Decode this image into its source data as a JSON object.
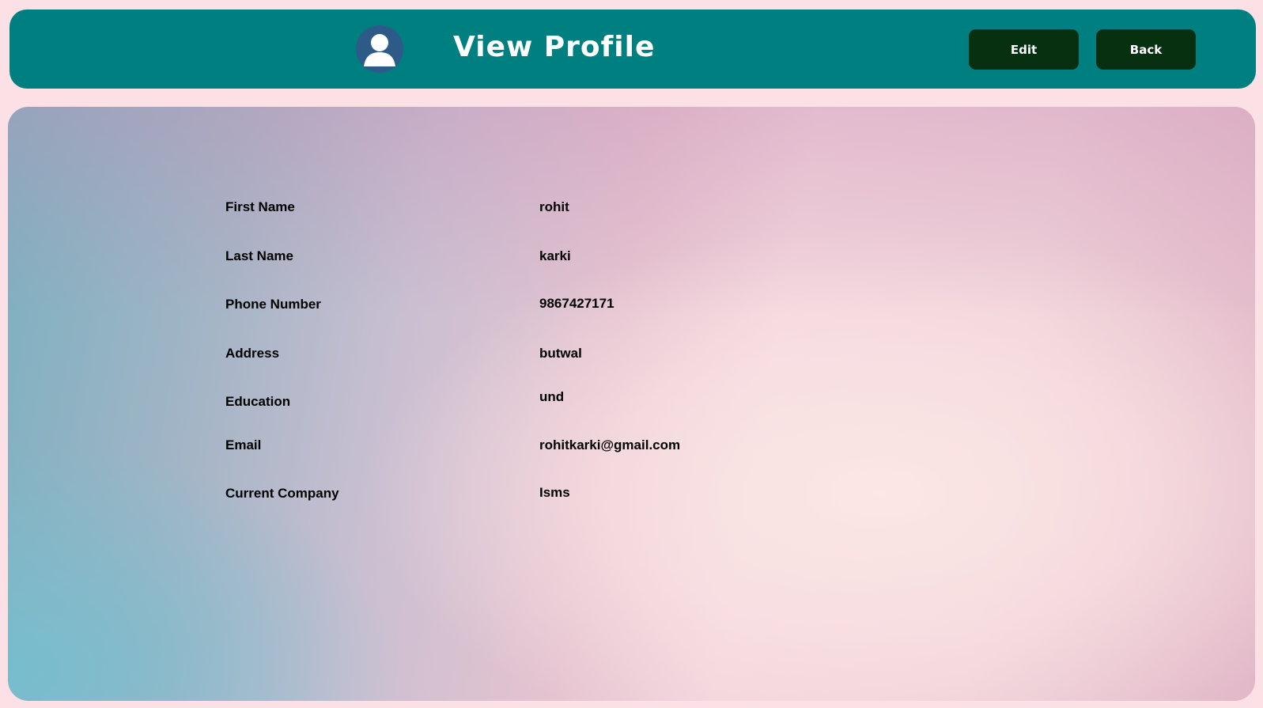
{
  "header": {
    "title": "View Profile",
    "edit_label": "Edit",
    "back_label": "Back",
    "avatar_icon": "user-avatar-icon",
    "background_color": "#007f80",
    "button_color": "#06300f"
  },
  "profile": {
    "fields": [
      {
        "label": "First Name",
        "value": "rohit"
      },
      {
        "label": "Last Name",
        "value": "karki"
      },
      {
        "label": "Phone Number",
        "value": "9867427171"
      },
      {
        "label": "Address",
        "value": "butwal"
      },
      {
        "label": "Education",
        "value": "und"
      },
      {
        "label": "Email",
        "value": "rohitkarki@gmail.com"
      },
      {
        "label": "Current Company",
        "value": "Isms"
      }
    ]
  }
}
